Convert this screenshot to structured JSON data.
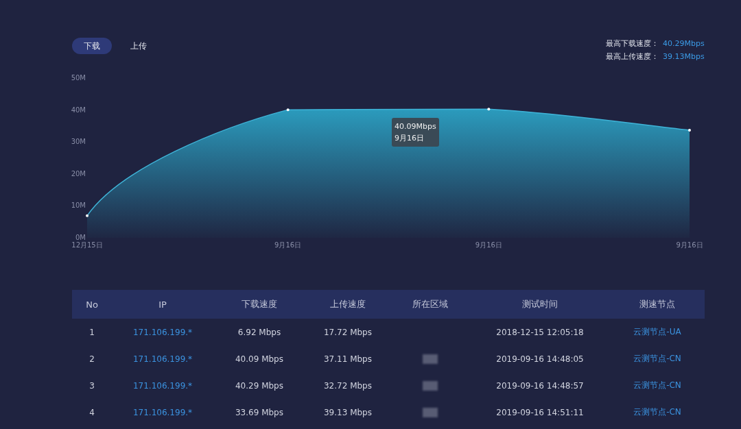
{
  "tabs": [
    {
      "label": "下载",
      "selected": true
    },
    {
      "label": "上传",
      "selected": false
    }
  ],
  "stats": [
    {
      "label": "最高下载速度：",
      "value": "40.29Mbps"
    },
    {
      "label": "最高上传速度：",
      "value": "39.13Mbps"
    }
  ],
  "chart_data": {
    "type": "area",
    "categories": [
      "12月15日",
      "9月16日",
      "9月16日",
      "9月16日"
    ],
    "series": [
      {
        "color": "#3fb4d8",
        "values": [
          6.9,
          40.1,
          40.3,
          33.7
        ]
      }
    ],
    "ylim": [
      0,
      50
    ],
    "yticks": [
      {
        "value": 0,
        "label": "0M"
      },
      {
        "value": 10,
        "label": "10M"
      },
      {
        "value": 20,
        "label": "20M"
      },
      {
        "value": 30,
        "label": "30M"
      },
      {
        "value": 40,
        "label": "40M"
      },
      {
        "value": 50,
        "label": "50M"
      }
    ]
  },
  "tooltip": {
    "value": "40.09Mbps",
    "date": "9月16日"
  },
  "table": {
    "columns": [
      "No",
      "IP",
      "下载速度",
      "上传速度",
      "所在区域",
      "测试时间",
      "测速节点"
    ],
    "rows": [
      {
        "no": "1",
        "ip": "171.106.199.*",
        "download": "6.92 Mbps",
        "upload": "17.72 Mbps",
        "region_redacted": false,
        "time": "2018-12-15 12:05:18",
        "node": "云测节点-UA"
      },
      {
        "no": "2",
        "ip": "171.106.199.*",
        "download": "40.09 Mbps",
        "upload": "37.11 Mbps",
        "region_redacted": true,
        "time": "2019-09-16 14:48:05",
        "node": "云测节点-CN"
      },
      {
        "no": "3",
        "ip": "171.106.199.*",
        "download": "40.29 Mbps",
        "upload": "32.72 Mbps",
        "region_redacted": true,
        "time": "2019-09-16 14:48:57",
        "node": "云测节点-CN"
      },
      {
        "no": "4",
        "ip": "171.106.199.*",
        "download": "33.69 Mbps",
        "upload": "39.13 Mbps",
        "region_redacted": true,
        "time": "2019-09-16 14:51:11",
        "node": "云测节点-CN"
      }
    ]
  }
}
